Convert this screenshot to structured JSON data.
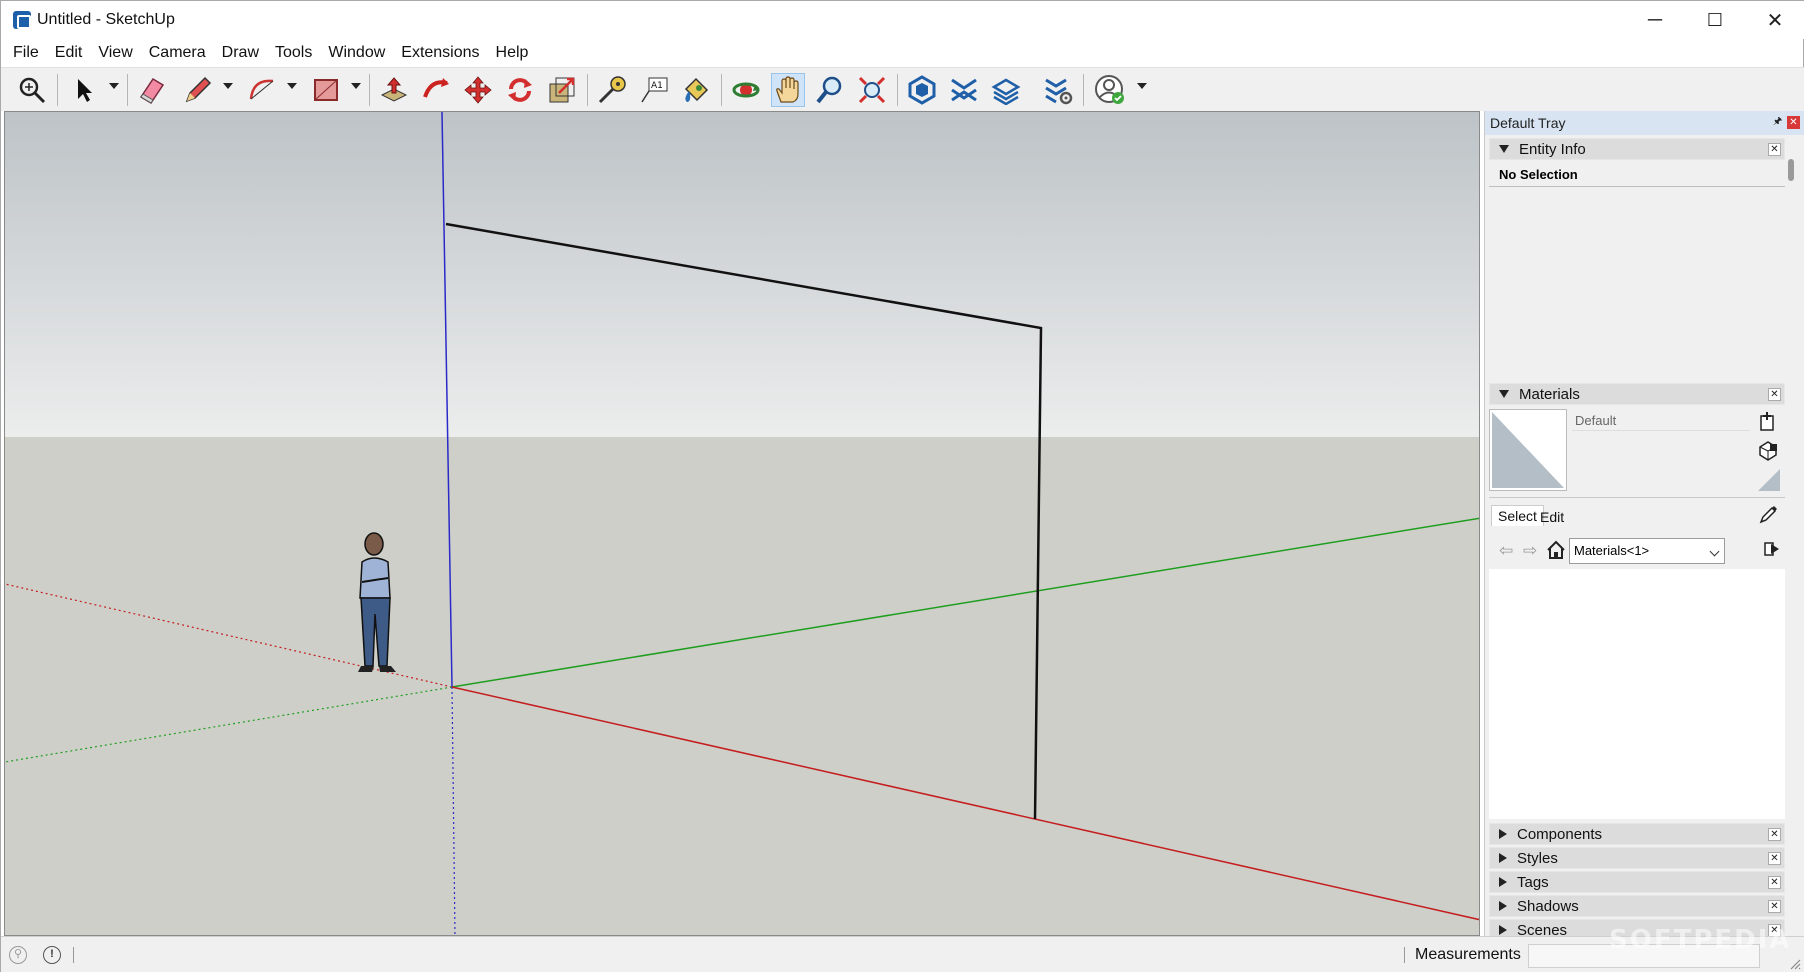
{
  "window": {
    "title": "Untitled - SketchUp",
    "controls": [
      "─",
      "☐",
      "✕"
    ]
  },
  "menu": [
    "File",
    "Edit",
    "View",
    "Camera",
    "Draw",
    "Tools",
    "Window",
    "Extensions",
    "Help"
  ],
  "tray": {
    "title": "Default Tray",
    "entity_info": {
      "label": "Entity Info",
      "selection": "No Selection"
    },
    "materials": {
      "label": "Materials",
      "current": "Default",
      "tabs": [
        "Select",
        "Edit"
      ],
      "collection": "Materials<1>"
    },
    "collapsed_panels": [
      "Components",
      "Styles",
      "Tags",
      "Shadows",
      "Scenes"
    ]
  },
  "status": {
    "measurements_label": "Measurements",
    "measurements_value": ""
  },
  "watermark": "SOFTPEDIA",
  "colors": {
    "blue_axis": "#2a2ac8",
    "red_axis": "#c41e1e",
    "green_axis": "#1e9e1e",
    "active_tool": "#cfe4f8"
  }
}
